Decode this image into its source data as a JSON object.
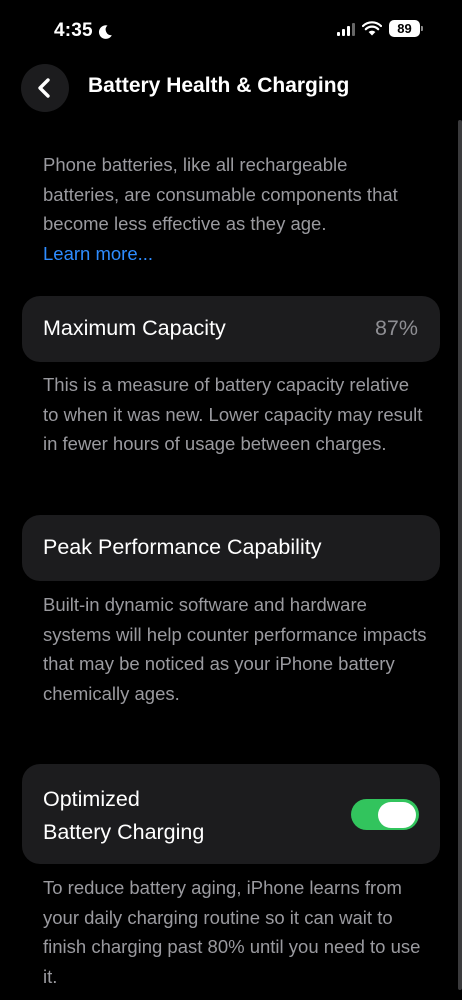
{
  "status_bar": {
    "time": "4:35",
    "battery_level": "89"
  },
  "nav": {
    "title": "Battery Health & Charging"
  },
  "intro": {
    "text": "Phone batteries, like all rechargeable batteries, are consumable components that become less effective as they age.",
    "link": "Learn more..."
  },
  "maximum_capacity": {
    "label": "Maximum Capacity",
    "value": "87%",
    "description": "This is a measure of battery capacity relative to when it was new. Lower capacity may result in fewer hours of usage between charges."
  },
  "peak_performance": {
    "label": "Peak Performance Capability",
    "description": "Built-in dynamic software and hardware systems will help counter performance impacts that may be noticed as your iPhone battery chemically ages."
  },
  "optimized_charging": {
    "label_line1": "Optimized",
    "label_line2": "Battery Charging",
    "enabled": true,
    "description": "To reduce battery aging, iPhone learns from your daily charging routine so it can wait to finish charging past 80% until you need to use it."
  },
  "colors": {
    "accent_link": "#2e8cff",
    "toggle_on": "#32c45d",
    "card_background": "#1c1c1e"
  },
  "icons": [
    "moon-icon",
    "cellular-signal-icon",
    "wifi-icon",
    "battery-icon",
    "chevron-left-icon"
  ]
}
